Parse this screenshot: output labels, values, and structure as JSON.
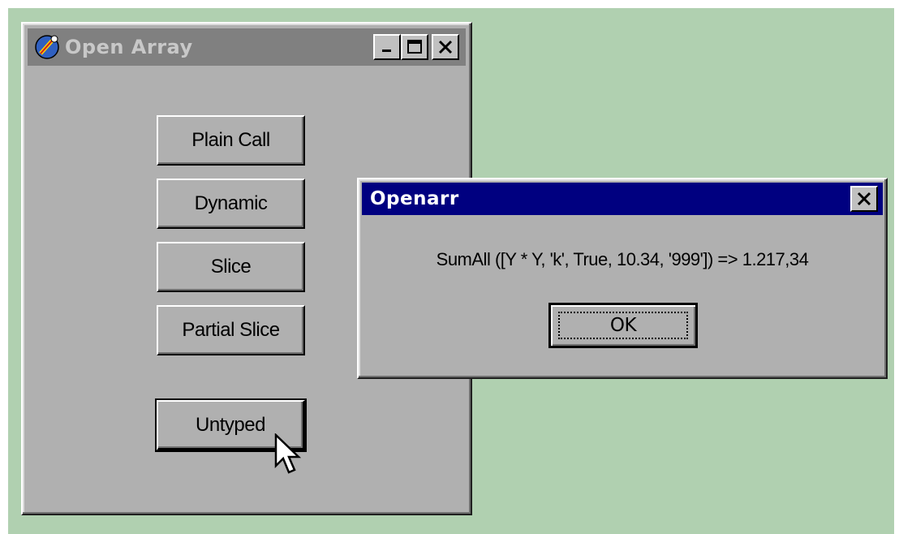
{
  "main_window": {
    "title": "Open Array",
    "icon": "delphi-app-icon",
    "caption_buttons": [
      "minimize-icon",
      "maximize-icon",
      "close-icon"
    ],
    "buttons": {
      "plain_call": "Plain Call",
      "dynamic": "Dynamic",
      "slice": "Slice",
      "partial_slice": "Partial Slice",
      "untyped": "Untyped"
    }
  },
  "dialog": {
    "title": "Openarr",
    "message": "SumAll ([Y * Y, 'k', True, 10.34, '999']) => 1.217,34",
    "ok_label": "OK",
    "close_icon": "close-icon"
  },
  "colors": {
    "desktop": "#b0d0b0",
    "window_face": "#b0b0b0",
    "inactive_title": "#808080",
    "active_title": "#000080"
  }
}
